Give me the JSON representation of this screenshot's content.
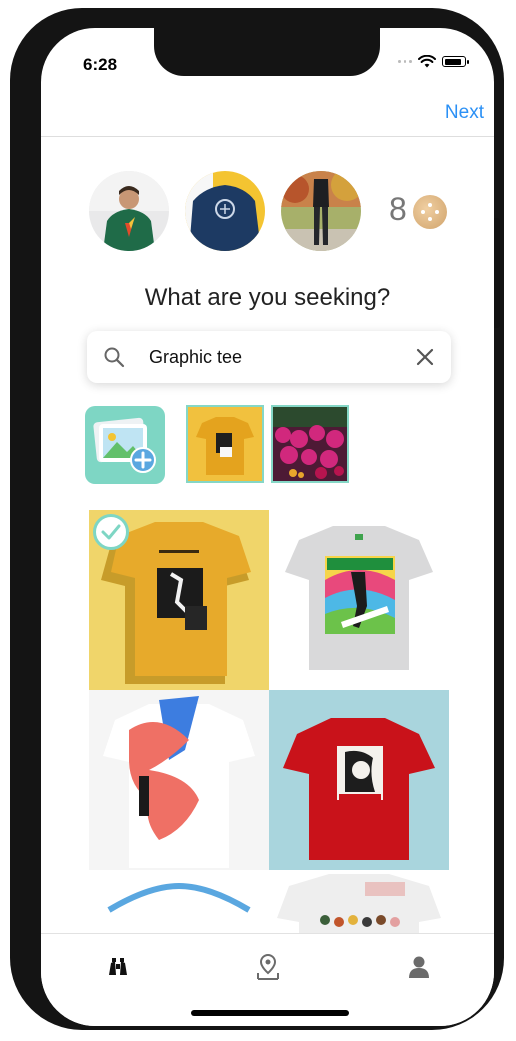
{
  "status": {
    "time": "6:28"
  },
  "nav": {
    "next_label": "Next"
  },
  "coins": {
    "count": "8"
  },
  "prompt": {
    "headline": "What are you seeking?"
  },
  "search": {
    "value": "Graphic tee"
  },
  "avatars": [
    {
      "label": "green hoodie"
    },
    {
      "label": "navy sweatshirt"
    },
    {
      "label": "autumn outfit"
    }
  ],
  "thumbnails": [
    {
      "label": "yellow tee photo"
    },
    {
      "label": "flower photo"
    }
  ],
  "results": [
    {
      "label": "yellow graphic tee",
      "selected": true
    },
    {
      "label": "fresh prince tee",
      "selected": false
    },
    {
      "label": "white abstract tee",
      "selected": false
    },
    {
      "label": "red graphic tee",
      "selected": false
    }
  ],
  "colors": {
    "accent": "#2b90f5",
    "teal": "#7ed6c4"
  },
  "tabs": [
    "binoculars-icon",
    "map-pin-icon",
    "user-icon"
  ]
}
